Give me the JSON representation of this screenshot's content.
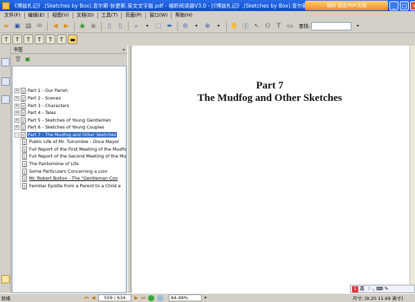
{
  "window": {
    "title": "《博兹札记》.(Sketches by Box).查尔斯·狄更斯.英文文字版.pdf - 福昕阅读器V3.0 - [《博兹札记》.(Sketches by Box).查尔斯·狄更...",
    "brand": "福昕 稳定PDF文档",
    "buttons": [
      "_",
      "□",
      "×"
    ]
  },
  "menu": {
    "items": [
      "文件(F)",
      "编辑(E)",
      "视图(V)",
      "文档(D)",
      "工具(T)",
      "页面(P)",
      "窗口(W)",
      "帮助(H)"
    ]
  },
  "toolbar": {
    "find_label": "查找:",
    "find_value": ""
  },
  "bookmarks": {
    "header": "书签",
    "collapse": "«",
    "items": [
      {
        "label": "Part 1 - Our Parish",
        "level": 0,
        "expander": "+"
      },
      {
        "label": "Part 2 - Scenes",
        "level": 0,
        "expander": "+"
      },
      {
        "label": "Part 3 - Characters",
        "level": 0,
        "expander": "+"
      },
      {
        "label": "Part 4 - Tales",
        "level": 0,
        "expander": "+"
      },
      {
        "label": "Part 5 - Sketches of Young Gentlemen",
        "level": 0,
        "expander": "+"
      },
      {
        "label": "Part 6 - Sketches of Young Couples",
        "level": 0,
        "expander": "+"
      },
      {
        "label": "Part 7 - The Mudfog and Other Sketches",
        "level": 0,
        "expander": "-",
        "selected": true
      },
      {
        "label": "Public Life of Mr. Tulrumble - Once Mayor",
        "level": 1
      },
      {
        "label": "Full Report of the First Meeting of the Mudfog",
        "level": 1
      },
      {
        "label": "Full Report of the Second Meeting of the Mud",
        "level": 1
      },
      {
        "label": "The Pantomime of Life",
        "level": 1
      },
      {
        "label": "Some Particulars Concerning a Lion",
        "level": 1
      },
      {
        "label": "Mr. Robert Bolton - The \"Gentleman Con",
        "level": 1,
        "underlined": true
      },
      {
        "label": "Familiar Epistle from a Parent to a Child a",
        "level": 1
      }
    ]
  },
  "document": {
    "part": "Part 7",
    "subtitle": "The Mudfog and Other Sketches"
  },
  "status": {
    "ready": "就绪",
    "page_counter": "559 / 634",
    "zoom": "84.49%",
    "size_label": "尺寸: [8.20   11.69 英寸]",
    "ime": "英"
  }
}
